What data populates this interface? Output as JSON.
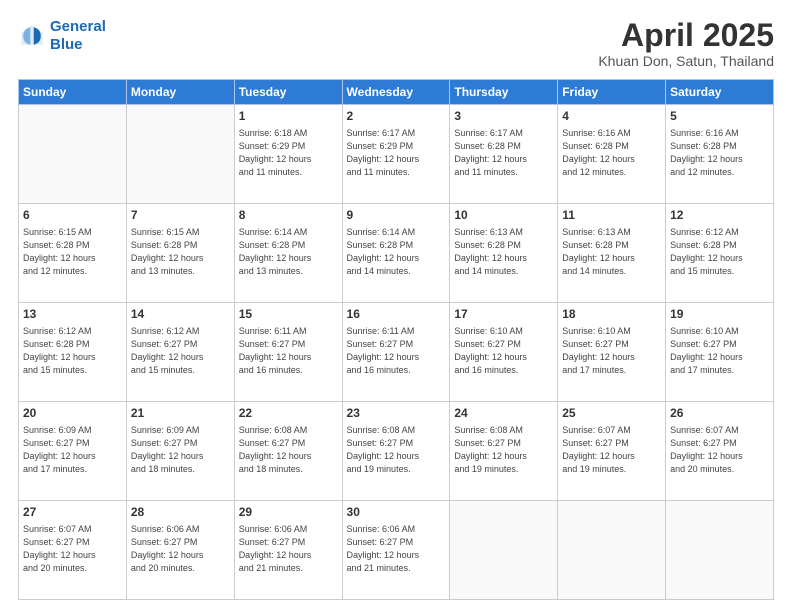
{
  "header": {
    "logo_line1": "General",
    "logo_line2": "Blue",
    "month": "April 2025",
    "location": "Khuan Don, Satun, Thailand"
  },
  "weekdays": [
    "Sunday",
    "Monday",
    "Tuesday",
    "Wednesday",
    "Thursday",
    "Friday",
    "Saturday"
  ],
  "weeks": [
    [
      {
        "day": "",
        "info": ""
      },
      {
        "day": "",
        "info": ""
      },
      {
        "day": "1",
        "info": "Sunrise: 6:18 AM\nSunset: 6:29 PM\nDaylight: 12 hours\nand 11 minutes."
      },
      {
        "day": "2",
        "info": "Sunrise: 6:17 AM\nSunset: 6:29 PM\nDaylight: 12 hours\nand 11 minutes."
      },
      {
        "day": "3",
        "info": "Sunrise: 6:17 AM\nSunset: 6:28 PM\nDaylight: 12 hours\nand 11 minutes."
      },
      {
        "day": "4",
        "info": "Sunrise: 6:16 AM\nSunset: 6:28 PM\nDaylight: 12 hours\nand 12 minutes."
      },
      {
        "day": "5",
        "info": "Sunrise: 6:16 AM\nSunset: 6:28 PM\nDaylight: 12 hours\nand 12 minutes."
      }
    ],
    [
      {
        "day": "6",
        "info": "Sunrise: 6:15 AM\nSunset: 6:28 PM\nDaylight: 12 hours\nand 12 minutes."
      },
      {
        "day": "7",
        "info": "Sunrise: 6:15 AM\nSunset: 6:28 PM\nDaylight: 12 hours\nand 13 minutes."
      },
      {
        "day": "8",
        "info": "Sunrise: 6:14 AM\nSunset: 6:28 PM\nDaylight: 12 hours\nand 13 minutes."
      },
      {
        "day": "9",
        "info": "Sunrise: 6:14 AM\nSunset: 6:28 PM\nDaylight: 12 hours\nand 14 minutes."
      },
      {
        "day": "10",
        "info": "Sunrise: 6:13 AM\nSunset: 6:28 PM\nDaylight: 12 hours\nand 14 minutes."
      },
      {
        "day": "11",
        "info": "Sunrise: 6:13 AM\nSunset: 6:28 PM\nDaylight: 12 hours\nand 14 minutes."
      },
      {
        "day": "12",
        "info": "Sunrise: 6:12 AM\nSunset: 6:28 PM\nDaylight: 12 hours\nand 15 minutes."
      }
    ],
    [
      {
        "day": "13",
        "info": "Sunrise: 6:12 AM\nSunset: 6:28 PM\nDaylight: 12 hours\nand 15 minutes."
      },
      {
        "day": "14",
        "info": "Sunrise: 6:12 AM\nSunset: 6:27 PM\nDaylight: 12 hours\nand 15 minutes."
      },
      {
        "day": "15",
        "info": "Sunrise: 6:11 AM\nSunset: 6:27 PM\nDaylight: 12 hours\nand 16 minutes."
      },
      {
        "day": "16",
        "info": "Sunrise: 6:11 AM\nSunset: 6:27 PM\nDaylight: 12 hours\nand 16 minutes."
      },
      {
        "day": "17",
        "info": "Sunrise: 6:10 AM\nSunset: 6:27 PM\nDaylight: 12 hours\nand 16 minutes."
      },
      {
        "day": "18",
        "info": "Sunrise: 6:10 AM\nSunset: 6:27 PM\nDaylight: 12 hours\nand 17 minutes."
      },
      {
        "day": "19",
        "info": "Sunrise: 6:10 AM\nSunset: 6:27 PM\nDaylight: 12 hours\nand 17 minutes."
      }
    ],
    [
      {
        "day": "20",
        "info": "Sunrise: 6:09 AM\nSunset: 6:27 PM\nDaylight: 12 hours\nand 17 minutes."
      },
      {
        "day": "21",
        "info": "Sunrise: 6:09 AM\nSunset: 6:27 PM\nDaylight: 12 hours\nand 18 minutes."
      },
      {
        "day": "22",
        "info": "Sunrise: 6:08 AM\nSunset: 6:27 PM\nDaylight: 12 hours\nand 18 minutes."
      },
      {
        "day": "23",
        "info": "Sunrise: 6:08 AM\nSunset: 6:27 PM\nDaylight: 12 hours\nand 19 minutes."
      },
      {
        "day": "24",
        "info": "Sunrise: 6:08 AM\nSunset: 6:27 PM\nDaylight: 12 hours\nand 19 minutes."
      },
      {
        "day": "25",
        "info": "Sunrise: 6:07 AM\nSunset: 6:27 PM\nDaylight: 12 hours\nand 19 minutes."
      },
      {
        "day": "26",
        "info": "Sunrise: 6:07 AM\nSunset: 6:27 PM\nDaylight: 12 hours\nand 20 minutes."
      }
    ],
    [
      {
        "day": "27",
        "info": "Sunrise: 6:07 AM\nSunset: 6:27 PM\nDaylight: 12 hours\nand 20 minutes."
      },
      {
        "day": "28",
        "info": "Sunrise: 6:06 AM\nSunset: 6:27 PM\nDaylight: 12 hours\nand 20 minutes."
      },
      {
        "day": "29",
        "info": "Sunrise: 6:06 AM\nSunset: 6:27 PM\nDaylight: 12 hours\nand 21 minutes."
      },
      {
        "day": "30",
        "info": "Sunrise: 6:06 AM\nSunset: 6:27 PM\nDaylight: 12 hours\nand 21 minutes."
      },
      {
        "day": "",
        "info": ""
      },
      {
        "day": "",
        "info": ""
      },
      {
        "day": "",
        "info": ""
      }
    ]
  ]
}
